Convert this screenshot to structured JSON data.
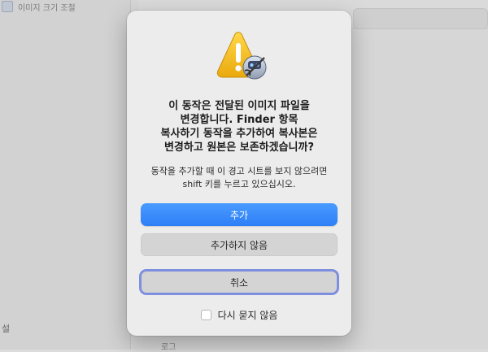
{
  "background": {
    "sidebar_item_label": "이미지 크기 조절",
    "sidebar_section_label": "설",
    "bottom_label": "로그"
  },
  "dialog": {
    "icon": "warning-triangle-with-automator-icon",
    "title": "이 동작은 전달된 이미지 파일을\n변경합니다.  Finder 항목\n복사하기 동작을 추가하여 복사본은\n변경하고 원본은 보존하겠습니까?",
    "message": "동작을 추가할 때 이 경고 시트를 보지 않으려면\nshift 키를 누르고 있으십시오.",
    "buttons": {
      "add": "추가",
      "dont_add": "추가하지 않음",
      "cancel": "취소"
    },
    "checkbox": {
      "label": "다시 묻지 않음",
      "checked": false
    }
  },
  "colors": {
    "primary_button": "#2d7ff7",
    "focus_ring": "#7f8fe0",
    "warning": "#f5c12e"
  }
}
